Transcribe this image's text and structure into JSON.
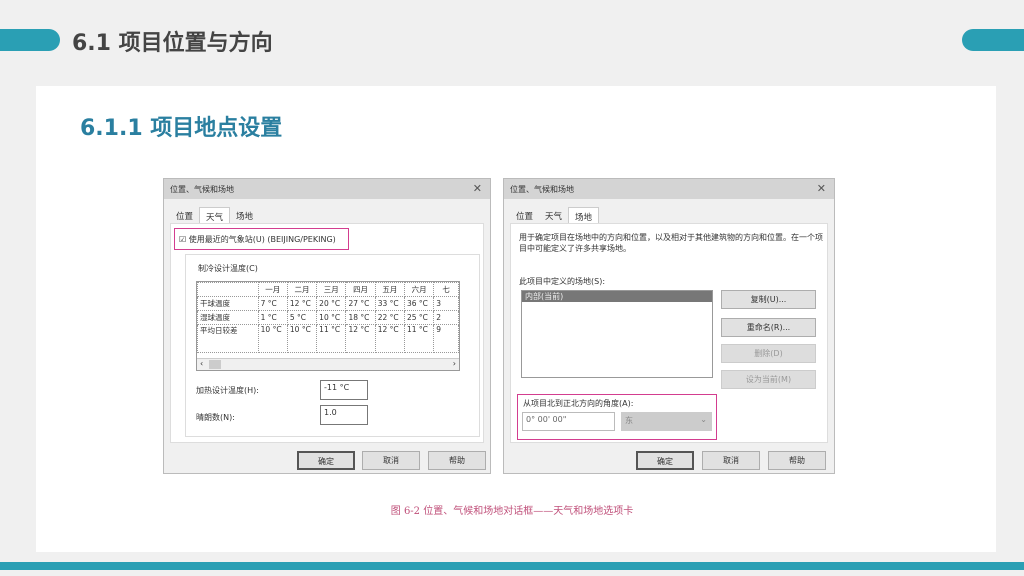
{
  "header": {
    "title": "6.1 项目位置与方向"
  },
  "section": {
    "title": "6.1.1 项目地点设置"
  },
  "dialog_left": {
    "title": "位置、气候和场地",
    "tabs": [
      "位置",
      "天气",
      "场地"
    ],
    "checkbox_label": "使用最近的气象站(U) (BEIJING/PEKING)",
    "group_label": "制冷设计温度(C)",
    "table": {
      "headers": [
        "",
        "一月",
        "二月",
        "三月",
        "四月",
        "五月",
        "六月",
        "七"
      ],
      "rows": [
        [
          "干球温度",
          "7 °C",
          "12 °C",
          "20 °C",
          "27 °C",
          "33 °C",
          "36 °C",
          "3"
        ],
        [
          "湿球温度",
          "1 °C",
          "5 °C",
          "10 °C",
          "18 °C",
          "22 °C",
          "25 °C",
          "2"
        ],
        [
          "平均日较差",
          "10 °C",
          "10 °C",
          "11 °C",
          "12 °C",
          "12 °C",
          "11 °C",
          "9"
        ]
      ]
    },
    "heating_label": "加热设计温度(H):",
    "heating_value": "-11 °C",
    "clearness_label": "晴朗数(N):",
    "clearness_value": "1.0",
    "ok": "确定",
    "cancel": "取消",
    "help": "帮助"
  },
  "dialog_right": {
    "title": "位置、气候和场地",
    "tabs": [
      "位置",
      "天气",
      "场地"
    ],
    "description": "用于确定项目在场地中的方向和位置，以及相对于其他建筑物的方向和位置。在一个项目中可能定义了许多共享场地。",
    "sites_label": "此项目中定义的场地(S):",
    "sites": [
      "内部(当前)"
    ],
    "duplicate": "复制(U)...",
    "rename": "重命名(R)...",
    "delete": "删除(D)",
    "make_current": "设为当前(M)",
    "angle_label": "从项目北到正北方向的角度(A):",
    "angle_value": "0° 00' 00\"",
    "direction": "东",
    "ok": "确定",
    "cancel": "取消",
    "help": "帮助"
  },
  "caption": "图 6-2   位置、气候和场地对话框——天气和场地选项卡"
}
